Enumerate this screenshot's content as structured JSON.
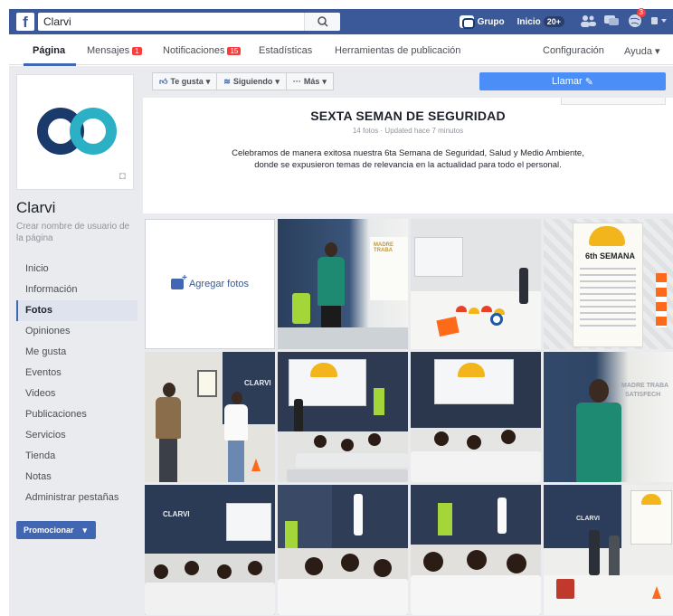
{
  "topbar": {
    "logo": "f",
    "search_value": "Clarvi",
    "group_label": "Grupo",
    "home_label": "Inicio",
    "home_count": "20+",
    "notif_count": "3"
  },
  "tabs": [
    {
      "label": "Página",
      "badge": ""
    },
    {
      "label": "Mensajes",
      "badge": "1"
    },
    {
      "label": "Notificaciones",
      "badge": "15"
    },
    {
      "label": "Estadísticas",
      "badge": ""
    },
    {
      "label": "Herramientas de publicación",
      "badge": ""
    },
    {
      "label": "Configuración",
      "badge": ""
    },
    {
      "label": "Ayuda ▾",
      "badge": ""
    }
  ],
  "sidebar": {
    "page_name": "Clarvi",
    "username_link": "Crear nombre de usuario de la página",
    "items": [
      "Inicio",
      "Información",
      "Fotos",
      "Opiniones",
      "Me gusta",
      "Eventos",
      "Videos",
      "Publicaciones",
      "Servicios",
      "Tienda",
      "Notas",
      "Administrar pestañas"
    ],
    "active_item": "Fotos",
    "promote_label": "Promocionar"
  },
  "actions": {
    "like_label": "Te gusta",
    "following_label": "Siguiendo",
    "more_label": "Más",
    "call_label": "Llamar"
  },
  "album": {
    "title": "SEXTA SEMAN DE SEGURIDAD",
    "meta": "14 fotos · Updated hace 7 minutos",
    "description": "Celebramos de manera exitosa nuestra 6ta Semana de Seguridad, Salud y Medio Ambiente, donde se expusieron temas de relevancia en la actualidad para todo el personal.",
    "add_photos_label": "Agregar fotos"
  },
  "photo_text": {
    "poster_title": "6th SEMANA",
    "banner": "MADRE TRABA",
    "banner2": "SATISFECH",
    "brand": "CLARVI"
  },
  "colors": {
    "fb_blue": "#3b5998",
    "button_blue": "#4267b2",
    "call_blue": "#4c8ef7",
    "logo_dark": "#1a3a6b",
    "logo_teal": "#2bb0c6"
  }
}
